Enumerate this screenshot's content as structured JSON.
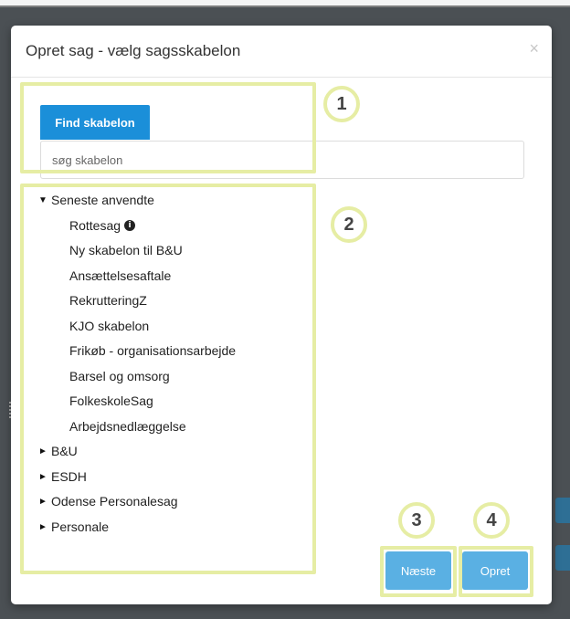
{
  "modal": {
    "title": "Opret sag - vælg sagsskabelon",
    "close_glyph": "×"
  },
  "search": {
    "tab_label": "Find skabelon",
    "placeholder": "søg skabelon",
    "value": ""
  },
  "tree": {
    "recent": {
      "label": "Seneste anvendte",
      "expanded": true,
      "items": [
        "Rottesag",
        "Ny skabelon til B&U",
        "Ansættelsesaftale",
        "RekrutteringZ",
        "KJO skabelon",
        "Frikøb - organisationsarbejde",
        "Barsel og omsorg",
        "FolkeskoleSag",
        "Arbejdsnedlæggelse"
      ]
    },
    "groups": [
      "B&U",
      "ESDH",
      "Odense Personalesag",
      "Personale"
    ]
  },
  "buttons": {
    "next_label": "Næste",
    "create_label": "Opret"
  },
  "callouts": [
    "1",
    "2",
    "3",
    "4"
  ],
  "colors": {
    "primary": "#1b8fd9",
    "button_light": "#5ab0e3",
    "highlight": "#e6eda4"
  },
  "icons": {
    "expanded": "▼",
    "collapsed": "►",
    "info": "i"
  }
}
